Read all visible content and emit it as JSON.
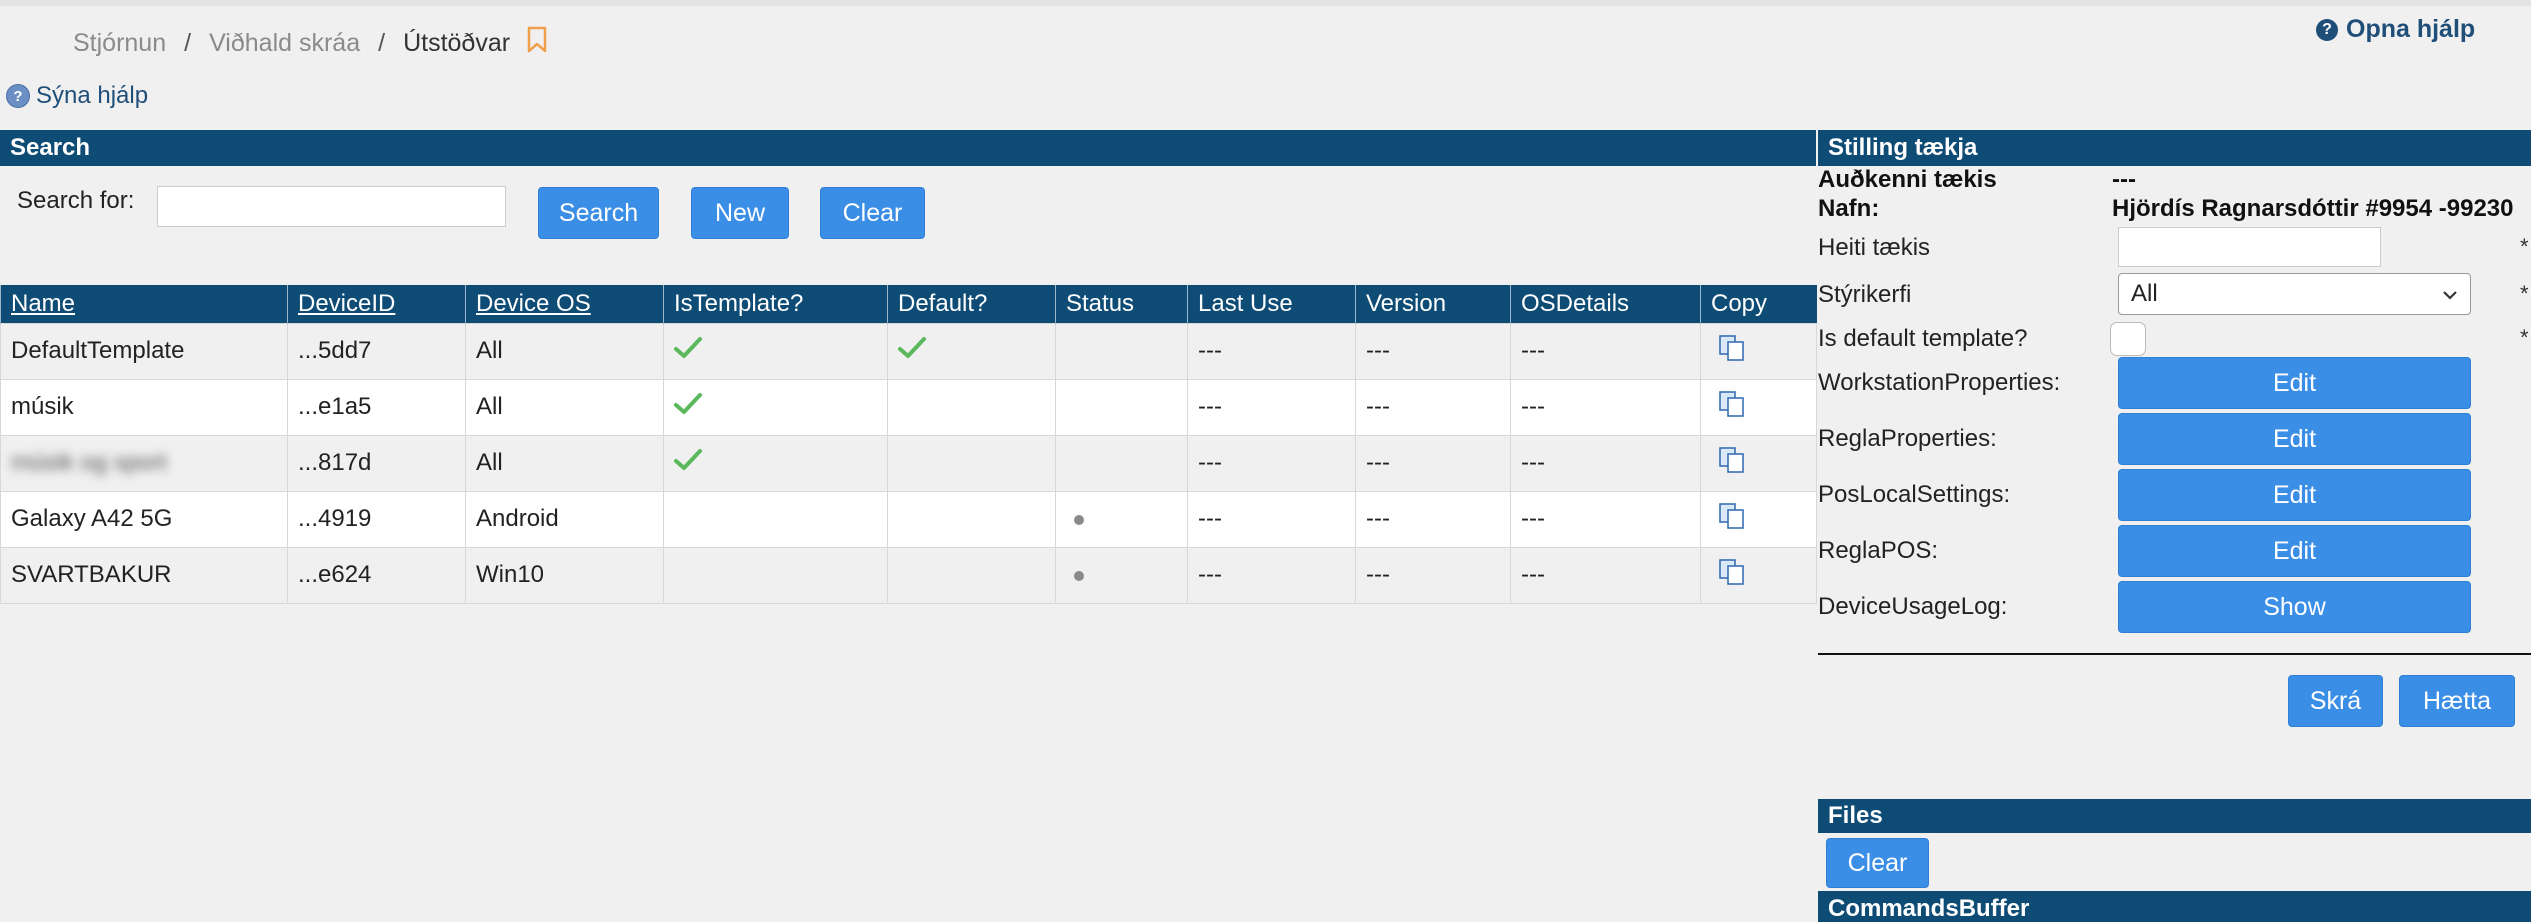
{
  "breadcrumb": {
    "items": [
      "Stjórnun",
      "Viðhald skráa",
      "Útstöðvar"
    ],
    "separator": "/"
  },
  "help": {
    "open_label": "Opna hjálp",
    "show_label": "Sýna hjálp"
  },
  "search": {
    "header": "Search",
    "label": "Search for:",
    "value": "",
    "search_button": "Search",
    "new_button": "New",
    "clear_button": "Clear"
  },
  "table": {
    "columns": [
      "Name",
      "DeviceID",
      "Device OS",
      "IsTemplate?",
      "Default?",
      "Status",
      "Last Use",
      "Version",
      "OSDetails",
      "Copy"
    ],
    "rows": [
      {
        "name": "DefaultTemplate",
        "device_id": "...5dd7",
        "os": "All",
        "is_template": true,
        "is_default": true,
        "status": "",
        "last_use": "---",
        "version": "---",
        "os_details": "---"
      },
      {
        "name": "músik",
        "device_id": "...e1a5",
        "os": "All",
        "is_template": true,
        "is_default": false,
        "status": "",
        "last_use": "---",
        "version": "---",
        "os_details": "---"
      },
      {
        "name": "músik og sport",
        "device_id": "...817d",
        "os": "All",
        "is_template": true,
        "is_default": false,
        "status": "",
        "last_use": "---",
        "version": "---",
        "os_details": "---"
      },
      {
        "name": "Galaxy A42 5G",
        "device_id": "...4919",
        "os": "Android",
        "is_template": false,
        "is_default": false,
        "status": "dot",
        "last_use": "---",
        "version": "---",
        "os_details": "---"
      },
      {
        "name": "SVARTBAKUR",
        "device_id": "...e624",
        "os": "Win10",
        "is_template": false,
        "is_default": false,
        "status": "dot",
        "last_use": "---",
        "version": "---",
        "os_details": "---"
      }
    ]
  },
  "device_settings": {
    "header": "Stilling tækja",
    "id_label": "Auðkenni tækis",
    "id_value": "---",
    "name_label": "Nafn:",
    "name_value": "Hjördís Ragnarsdóttir #9954 -99230",
    "device_name_label": "Heiti tækis",
    "device_name_value": "",
    "os_label": "Stýrikerfi",
    "os_value": "All",
    "default_template_label": "Is default template?",
    "required_mark": "*",
    "properties": [
      {
        "label": "WorkstationProperties:",
        "button": "Edit"
      },
      {
        "label": "ReglaProperties:",
        "button": "Edit"
      },
      {
        "label": "PosLocalSettings:",
        "button": "Edit"
      },
      {
        "label": "ReglaPOS:",
        "button": "Edit"
      },
      {
        "label": "DeviceUsageLog:",
        "button": "Show"
      }
    ],
    "save_button": "Skrá",
    "cancel_button": "Hætta"
  },
  "files": {
    "header": "Files",
    "clear_button": "Clear"
  },
  "commands_buffer": {
    "header": "CommandsBuffer"
  },
  "colors": {
    "header_bg": "#0f4c75",
    "button_bg": "#3b8ee6",
    "bookmark": "#f0a04b",
    "check": "#5cb85c"
  },
  "icons": {
    "bookmark": "bookmark-icon",
    "help": "question-circle-icon",
    "check": "check-icon",
    "copy": "copy-icon",
    "chevron": "chevron-down-icon"
  }
}
